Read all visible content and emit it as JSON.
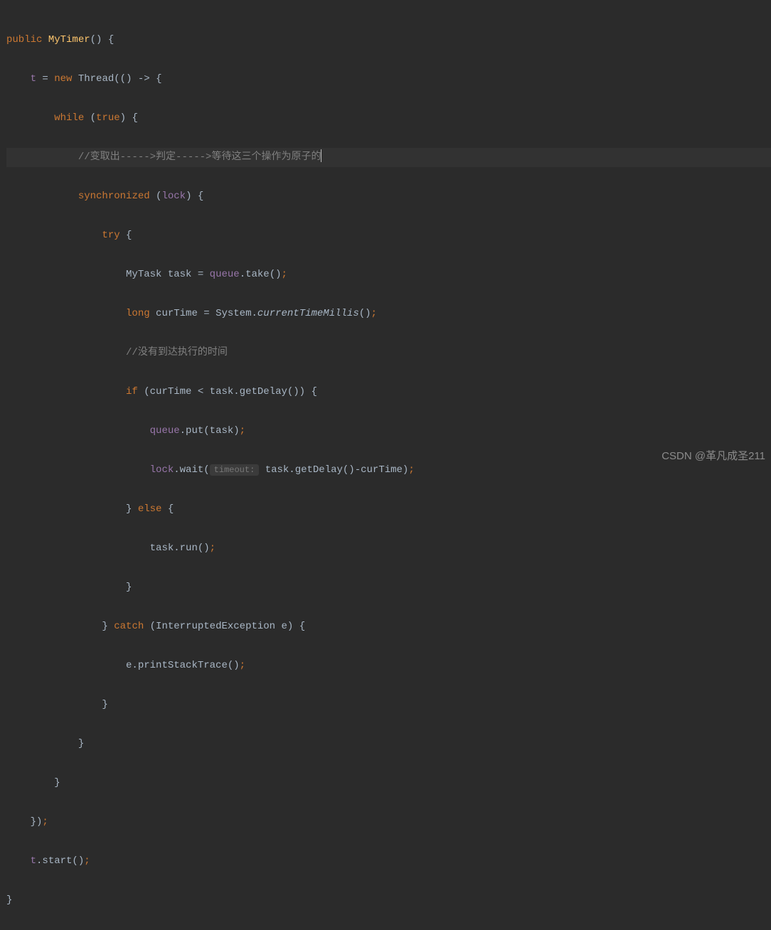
{
  "code": {
    "l1": {
      "public": "public",
      "classname": "MyTimer",
      "parens": "()",
      "brace": " {"
    },
    "l2": {
      "ind": "    ",
      "t": "t",
      "eq": " = ",
      "new": "new ",
      "thread": "Thread",
      "lambda": "(() -> {"
    },
    "l3": {
      "ind": "        ",
      "while": "while ",
      "lpar": "(",
      "true": "true",
      "rpar": ") {"
    },
    "l4": {
      "ind": "            ",
      "comment": "//变取出----->判定----->等待这三个操作为原子的"
    },
    "l5": {
      "ind": "            ",
      "sync": "synchronized ",
      "lpar": "(",
      "lock": "lock",
      "rpar": ") {"
    },
    "l6": {
      "ind": "                ",
      "try": "try ",
      "brace": "{"
    },
    "l7": {
      "ind": "                    ",
      "type": "MyTask ",
      "var": "task ",
      "eq": "= ",
      "queue": "queue",
      "call": ".take()",
      "semi": ";"
    },
    "l8": {
      "ind": "                    ",
      "long": "long ",
      "var": "curTime ",
      "eq": "= ",
      "sys": "System.",
      "method": "currentTimeMillis",
      "parens": "()",
      "semi": ";"
    },
    "l9": {
      "ind": "                    ",
      "comment": "//没有到达执行的时间"
    },
    "l10": {
      "ind": "                    ",
      "if": "if ",
      "cond": "(curTime < task.getDelay()) {"
    },
    "l11": {
      "ind": "                        ",
      "queue": "queue",
      "call": ".put(task)",
      "semi": ";"
    },
    "l12": {
      "ind": "                        ",
      "lock": "lock",
      "wait": ".wait(",
      "hint": "timeout:",
      "sp": " ",
      "arg": "task.getDelay()-curTime)",
      "semi": ";"
    },
    "l13": {
      "ind": "                    ",
      "close": "} ",
      "else": "else ",
      "brace": "{"
    },
    "l14": {
      "ind": "                        ",
      "call": "task.run()",
      "semi": ";"
    },
    "l15": {
      "ind": "                    ",
      "close": "}"
    },
    "l16": {
      "ind": "                ",
      "close": "} ",
      "catch": "catch ",
      "exc": "(InterruptedException e) {"
    },
    "l17": {
      "ind": "                    ",
      "call": "e.printStackTrace()",
      "semi": ";"
    },
    "l18": {
      "ind": "                ",
      "close": "}"
    },
    "l19": {
      "ind": "            ",
      "close": "}"
    },
    "l20": {
      "ind": "        ",
      "close": "}"
    },
    "l21": {
      "ind": "    ",
      "close": "})",
      "semi": ";"
    },
    "l22": {
      "ind": "    ",
      "t": "t",
      "call": ".start()",
      "semi": ";"
    },
    "l23": {
      "close": "}"
    }
  },
  "watermark": "CSDN @革凡成圣211"
}
